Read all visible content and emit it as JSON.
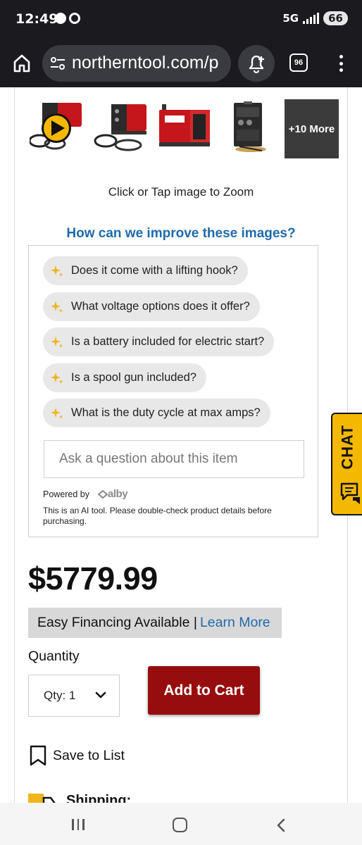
{
  "status_bar": {
    "time": "12:49",
    "network": "5G",
    "battery": "66"
  },
  "browser": {
    "url": "northerntool.com/p",
    "tab_count": "96"
  },
  "gallery": {
    "thumbnails": [
      "welder-video",
      "welder-side",
      "welder-red-front",
      "welder-panel"
    ],
    "more_label": "+10 More",
    "zoom_hint": "Click or Tap image to Zoom",
    "improve_link": "How can we improve these images?"
  },
  "ai_qa": {
    "suggestions": [
      "Does it come with a lifting hook?",
      "What voltage options does it offer?",
      "Is a battery included for electric start?",
      "Is a spool gun included?",
      "What is the duty cycle at max amps?"
    ],
    "input_placeholder": "Ask a question about this item",
    "powered_by": "Powered by",
    "brand": "alby",
    "disclaimer": "This is an AI tool. Please double-check product details before purchasing."
  },
  "product": {
    "price": "$5779.99",
    "financing_text": "Easy Financing Available |",
    "financing_link": "Learn More",
    "quantity_label": "Quantity",
    "quantity_value": "Qty: 1",
    "add_to_cart": "Add to Cart",
    "save_to_list": "Save to List",
    "shipping_label": "Shipping:"
  },
  "chat": {
    "label": "CHAT"
  },
  "colors": {
    "brand_red": "#970d0d",
    "link_blue": "#1f6aab",
    "chat_yellow": "#f5b800",
    "sparkle": "#f0b41c"
  },
  "icons": {
    "home": "home-icon",
    "site_settings": "site-settings-icon",
    "tab_alert": "bell-plus-icon",
    "menu": "more-vert-icon",
    "play": "play-icon",
    "sparkle": "sparkle-icon",
    "bookmark": "bookmark-icon",
    "shipping": "truck-icon",
    "chat": "chat-bubble-icon",
    "chevron": "chevron-down-icon"
  }
}
